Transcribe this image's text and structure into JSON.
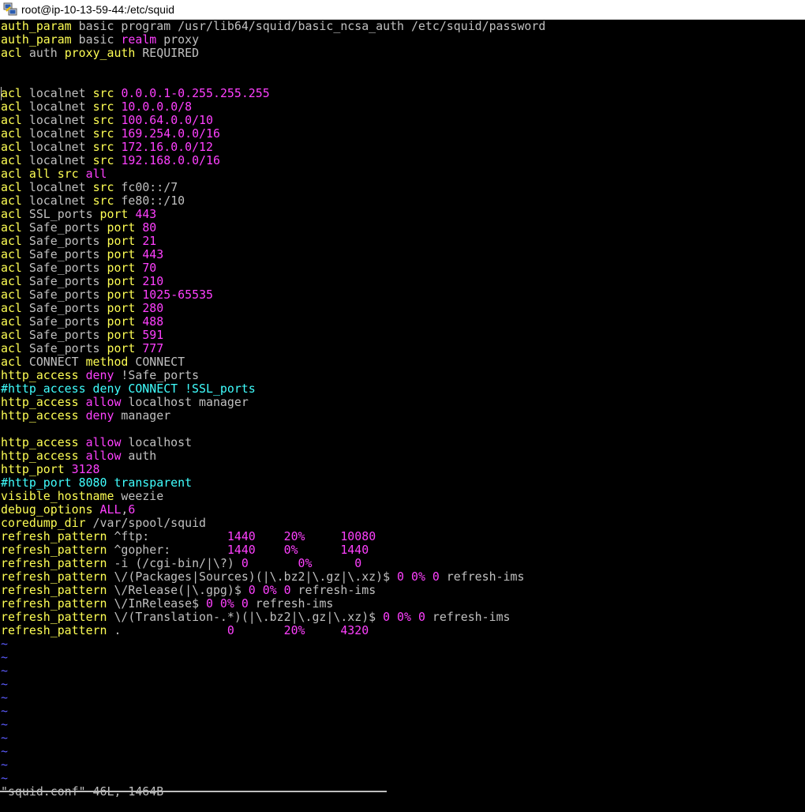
{
  "window": {
    "title": "root@ip-10-13-59-44:/etc/squid",
    "icon": "putty-icon"
  },
  "colors": {
    "keyword": "#ffff54",
    "value": "#ff40ff",
    "comment": "#40ffff",
    "text": "#c0c0c0",
    "tilde": "#5c5cff",
    "background": "#000000"
  },
  "lines": [
    [
      [
        "y",
        "auth_param"
      ],
      [
        "d",
        " basic program /usr/lib64/squid/basic_ncsa_auth /etc/squid/password"
      ]
    ],
    [
      [
        "y",
        "auth_param"
      ],
      [
        "d",
        " basic "
      ],
      [
        "m",
        "realm"
      ],
      [
        "d",
        " proxy"
      ]
    ],
    [
      [
        "y",
        "acl"
      ],
      [
        "d",
        " auth "
      ],
      [
        "y",
        "proxy_auth"
      ],
      [
        "d",
        " REQUIRED"
      ]
    ],
    [],
    [],
    [
      [
        "y",
        "acl"
      ],
      [
        "d",
        " localnet "
      ],
      [
        "y",
        "src"
      ],
      [
        "d",
        " "
      ],
      [
        "m",
        "0.0.0.1-0.255.255.255"
      ]
    ],
    [
      [
        "y",
        "acl"
      ],
      [
        "d",
        " localnet "
      ],
      [
        "y",
        "src"
      ],
      [
        "d",
        " "
      ],
      [
        "m",
        "10.0.0.0/8"
      ]
    ],
    [
      [
        "y",
        "acl"
      ],
      [
        "d",
        " localnet "
      ],
      [
        "y",
        "src"
      ],
      [
        "d",
        " "
      ],
      [
        "m",
        "100.64.0.0/10"
      ]
    ],
    [
      [
        "y",
        "acl"
      ],
      [
        "d",
        " localnet "
      ],
      [
        "y",
        "src"
      ],
      [
        "d",
        " "
      ],
      [
        "m",
        "169.254.0.0/16"
      ]
    ],
    [
      [
        "y",
        "acl"
      ],
      [
        "d",
        " localnet "
      ],
      [
        "y",
        "src"
      ],
      [
        "d",
        " "
      ],
      [
        "m",
        "172.16.0.0/12"
      ]
    ],
    [
      [
        "y",
        "acl"
      ],
      [
        "d",
        " localnet "
      ],
      [
        "y",
        "src"
      ],
      [
        "d",
        " "
      ],
      [
        "m",
        "192.168.0.0/16"
      ]
    ],
    [
      [
        "y",
        "acl"
      ],
      [
        "d",
        " "
      ],
      [
        "y",
        "all"
      ],
      [
        "d",
        " "
      ],
      [
        "y",
        "src"
      ],
      [
        "d",
        " "
      ],
      [
        "m",
        "all"
      ]
    ],
    [
      [
        "y",
        "acl"
      ],
      [
        "d",
        " localnet "
      ],
      [
        "y",
        "src"
      ],
      [
        "d",
        " fc00::/7"
      ]
    ],
    [
      [
        "y",
        "acl"
      ],
      [
        "d",
        " localnet "
      ],
      [
        "y",
        "src"
      ],
      [
        "d",
        " fe80::/10"
      ]
    ],
    [
      [
        "y",
        "acl"
      ],
      [
        "d",
        " SSL_ports "
      ],
      [
        "y",
        "port"
      ],
      [
        "d",
        " "
      ],
      [
        "m",
        "443"
      ]
    ],
    [
      [
        "y",
        "acl"
      ],
      [
        "d",
        " Safe_ports "
      ],
      [
        "y",
        "port"
      ],
      [
        "d",
        " "
      ],
      [
        "m",
        "80"
      ]
    ],
    [
      [
        "y",
        "acl"
      ],
      [
        "d",
        " Safe_ports "
      ],
      [
        "y",
        "port"
      ],
      [
        "d",
        " "
      ],
      [
        "m",
        "21"
      ]
    ],
    [
      [
        "y",
        "acl"
      ],
      [
        "d",
        " Safe_ports "
      ],
      [
        "y",
        "port"
      ],
      [
        "d",
        " "
      ],
      [
        "m",
        "443"
      ]
    ],
    [
      [
        "y",
        "acl"
      ],
      [
        "d",
        " Safe_ports "
      ],
      [
        "y",
        "port"
      ],
      [
        "d",
        " "
      ],
      [
        "m",
        "70"
      ]
    ],
    [
      [
        "y",
        "acl"
      ],
      [
        "d",
        " Safe_ports "
      ],
      [
        "y",
        "port"
      ],
      [
        "d",
        " "
      ],
      [
        "m",
        "210"
      ]
    ],
    [
      [
        "y",
        "acl"
      ],
      [
        "d",
        " Safe_ports "
      ],
      [
        "y",
        "port"
      ],
      [
        "d",
        " "
      ],
      [
        "m",
        "1025-65535"
      ]
    ],
    [
      [
        "y",
        "acl"
      ],
      [
        "d",
        " Safe_ports "
      ],
      [
        "y",
        "port"
      ],
      [
        "d",
        " "
      ],
      [
        "m",
        "280"
      ]
    ],
    [
      [
        "y",
        "acl"
      ],
      [
        "d",
        " Safe_ports "
      ],
      [
        "y",
        "port"
      ],
      [
        "d",
        " "
      ],
      [
        "m",
        "488"
      ]
    ],
    [
      [
        "y",
        "acl"
      ],
      [
        "d",
        " Safe_ports "
      ],
      [
        "y",
        "port"
      ],
      [
        "d",
        " "
      ],
      [
        "m",
        "591"
      ]
    ],
    [
      [
        "y",
        "acl"
      ],
      [
        "d",
        " Safe_ports "
      ],
      [
        "y",
        "port"
      ],
      [
        "d",
        " "
      ],
      [
        "m",
        "777"
      ]
    ],
    [
      [
        "y",
        "acl"
      ],
      [
        "d",
        " CONNECT "
      ],
      [
        "y",
        "method"
      ],
      [
        "d",
        " CONNECT"
      ]
    ],
    [
      [
        "y",
        "http_access"
      ],
      [
        "d",
        " "
      ],
      [
        "m",
        "deny"
      ],
      [
        "d",
        " !Safe_ports"
      ]
    ],
    [
      [
        "c",
        "#http_access deny CONNECT !SSL_ports"
      ]
    ],
    [
      [
        "y",
        "http_access"
      ],
      [
        "d",
        " "
      ],
      [
        "m",
        "allow"
      ],
      [
        "d",
        " localhost manager"
      ]
    ],
    [
      [
        "y",
        "http_access"
      ],
      [
        "d",
        " "
      ],
      [
        "m",
        "deny"
      ],
      [
        "d",
        " manager"
      ]
    ],
    [],
    [
      [
        "y",
        "http_access"
      ],
      [
        "d",
        " "
      ],
      [
        "m",
        "allow"
      ],
      [
        "d",
        " localhost"
      ]
    ],
    [
      [
        "y",
        "http_access"
      ],
      [
        "d",
        " "
      ],
      [
        "m",
        "allow"
      ],
      [
        "d",
        " auth"
      ]
    ],
    [
      [
        "y",
        "http_port"
      ],
      [
        "d",
        " "
      ],
      [
        "m",
        "3128"
      ]
    ],
    [
      [
        "c",
        "#http_port 8080 transparent"
      ]
    ],
    [
      [
        "y",
        "visible_hostname"
      ],
      [
        "d",
        " weezie"
      ]
    ],
    [
      [
        "y",
        "debug_options"
      ],
      [
        "d",
        " "
      ],
      [
        "m",
        "ALL"
      ],
      [
        "d",
        ","
      ],
      [
        "m",
        "6"
      ]
    ],
    [
      [
        "y",
        "coredump_dir"
      ],
      [
        "d",
        " /var/spool/squid"
      ]
    ],
    [
      [
        "y",
        "refresh_pattern"
      ],
      [
        "d",
        " ^ftp:           "
      ],
      [
        "m",
        "1440    20%     10080"
      ]
    ],
    [
      [
        "y",
        "refresh_pattern"
      ],
      [
        "d",
        " ^gopher:        "
      ],
      [
        "m",
        "1440    0%      1440"
      ]
    ],
    [
      [
        "y",
        "refresh_pattern"
      ],
      [
        "d",
        " -i (/cgi-bin/|\\?) "
      ],
      [
        "m",
        "0       0%      0"
      ]
    ],
    [
      [
        "y",
        "refresh_pattern"
      ],
      [
        "d",
        " \\/(Packages|Sources)(|\\.bz2|\\.gz|\\.xz)$ "
      ],
      [
        "m",
        "0 0% 0"
      ],
      [
        "d",
        " refresh-ims"
      ]
    ],
    [
      [
        "y",
        "refresh_pattern"
      ],
      [
        "d",
        " \\/Release(|\\.gpg)$ "
      ],
      [
        "m",
        "0 0% 0"
      ],
      [
        "d",
        " refresh-ims"
      ]
    ],
    [
      [
        "y",
        "refresh_pattern"
      ],
      [
        "d",
        " \\/InRelease$ "
      ],
      [
        "m",
        "0 0% 0"
      ],
      [
        "d",
        " refresh-ims"
      ]
    ],
    [
      [
        "y",
        "refresh_pattern"
      ],
      [
        "d",
        " \\/(Translation-.*)(|\\.bz2|\\.gz|\\.xz)$ "
      ],
      [
        "m",
        "0 0% 0"
      ],
      [
        "d",
        " refresh-ims"
      ]
    ],
    [
      [
        "y",
        "refresh_pattern"
      ],
      [
        "d",
        " .               "
      ],
      [
        "m",
        "0       20%     4320"
      ]
    ],
    [
      [
        "t",
        "~"
      ]
    ],
    [
      [
        "t",
        "~"
      ]
    ],
    [
      [
        "t",
        "~"
      ]
    ],
    [
      [
        "t",
        "~"
      ]
    ],
    [
      [
        "t",
        "~"
      ]
    ],
    [
      [
        "t",
        "~"
      ]
    ],
    [
      [
        "t",
        "~"
      ]
    ],
    [
      [
        "t",
        "~"
      ]
    ],
    [
      [
        "t",
        "~"
      ]
    ],
    [
      [
        "t",
        "~"
      ]
    ],
    [
      [
        "t",
        "~"
      ]
    ]
  ],
  "status": "\"squid.conf\" 46L, 1464B"
}
